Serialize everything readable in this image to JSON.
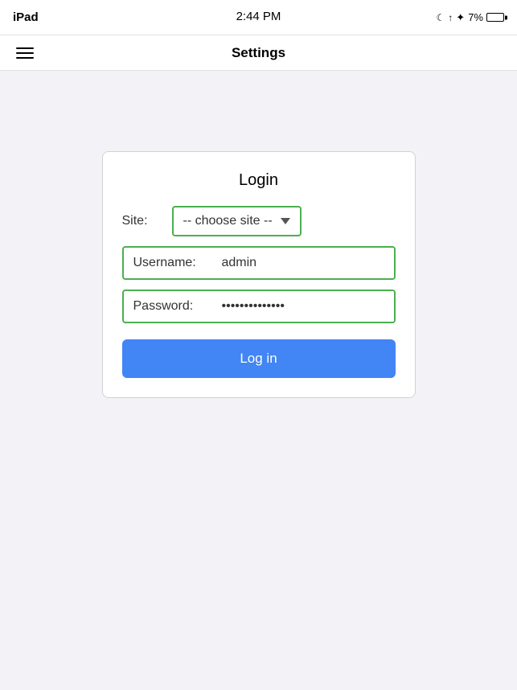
{
  "status_bar": {
    "device": "iPad",
    "time": "2:44 PM",
    "battery_percent": "7%",
    "icons": {
      "moon": "☾",
      "arrow": "↑",
      "bluetooth": "✦"
    }
  },
  "nav": {
    "title": "Settings",
    "menu_label": "Menu"
  },
  "login": {
    "title": "Login",
    "site_label": "Site:",
    "site_placeholder": "-- choose site --",
    "username_label": "Username:",
    "username_value": "admin",
    "password_label": "Password:",
    "password_value": "••••••••••••••",
    "login_button": "Log in"
  }
}
